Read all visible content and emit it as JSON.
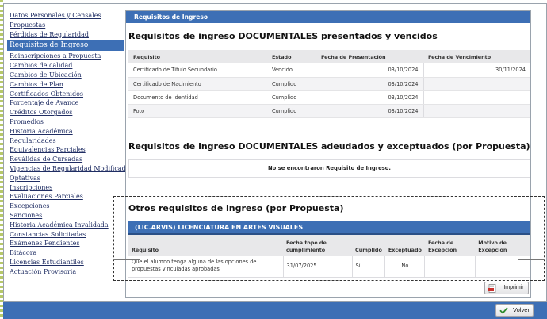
{
  "sidebar": {
    "items": [
      {
        "label": "Datos Personales y Censales",
        "active": false
      },
      {
        "label": "Propuestas",
        "active": false
      },
      {
        "label": "Pérdidas de Regularidad",
        "active": false
      },
      {
        "label": "Requisitos de Ingreso",
        "active": true
      },
      {
        "label": "Reinscripciones a Propuesta",
        "active": false
      },
      {
        "label": "Cambios de calidad",
        "active": false
      },
      {
        "label": "Cambios de Ubicación",
        "active": false
      },
      {
        "label": "Cambios de Plan",
        "active": false
      },
      {
        "label": "Certificados Obtenidos",
        "active": false
      },
      {
        "label": "Porcentaje de Avance",
        "active": false
      },
      {
        "label": "Créditos Otorgados",
        "active": false
      },
      {
        "label": "Promedios",
        "active": false
      },
      {
        "label": "Historia Académica",
        "active": false
      },
      {
        "label": "Regularidades",
        "active": false
      },
      {
        "label": "Equivalencias Parciales",
        "active": false
      },
      {
        "label": "Reválidas de Cursadas",
        "active": false
      },
      {
        "label": "Vigencias de Regularidad Modificadas",
        "active": false
      },
      {
        "label": "Optativas",
        "active": false
      },
      {
        "label": "Inscripciones",
        "active": false
      },
      {
        "label": "Evaluaciones Parciales",
        "active": false
      },
      {
        "label": "Excepciones",
        "active": false
      },
      {
        "label": "Sanciones",
        "active": false
      },
      {
        "label": "Historia Académica Invalidada",
        "active": false
      },
      {
        "label": "Constancias Solicitadas",
        "active": false
      },
      {
        "label": "Exámenes Pendientes",
        "active": false
      },
      {
        "label": "Bitácora",
        "active": false
      },
      {
        "label": "Licencias Estudiantiles",
        "active": false
      },
      {
        "label": "Actuación Provisoria",
        "active": false
      }
    ]
  },
  "main": {
    "header": "Requisitos de Ingreso",
    "section1": {
      "title": "Requisitos de ingreso DOCUMENTALES presentados y vencidos",
      "columns": [
        "Requisito",
        "Estado",
        "Fecha de Presentación",
        "Fecha de Vencimiento"
      ],
      "rows": [
        {
          "requisito": "Certificado de Título Secundario",
          "estado": "Vencido",
          "presentacion": "03/10/2024",
          "vencimiento": "30/11/2024"
        },
        {
          "requisito": "Certificado de Nacimiento",
          "estado": "Cumplido",
          "presentacion": "03/10/2024",
          "vencimiento": ""
        },
        {
          "requisito": "Documento de Identidad",
          "estado": "Cumplido",
          "presentacion": "03/10/2024",
          "vencimiento": ""
        },
        {
          "requisito": "Foto",
          "estado": "Cumplido",
          "presentacion": "03/10/2024",
          "vencimiento": ""
        }
      ]
    },
    "section2": {
      "title": "Requisitos de ingreso DOCUMENTALES adeudados y exceptuados (por Propuesta)",
      "empty_message": "No se encontraron Requisito de Ingreso."
    },
    "section3": {
      "title": "Otros requisitos de ingreso (por Propuesta)",
      "propuesta": "(LIC.ARVIS) LICENCIATURA EN ARTES VISUALES",
      "columns": [
        "Requisito",
        "Fecha tope de cumplimiento",
        "Cumplido",
        "Exceptuado",
        "Fecha de Excepción",
        "Motivo de Excepción"
      ],
      "rows": [
        {
          "requisito": "Que el alumno tenga alguna de las opciones de propuestas vinculadas aprobadas",
          "fecha_tope": "31/07/2025",
          "cumplido": "Sí",
          "exceptuado": "No",
          "fecha_excepcion": "",
          "motivo": ""
        }
      ]
    },
    "print_label": "Imprimir"
  },
  "footer": {
    "volver_label": "Volver"
  },
  "colors": {
    "accent": "#3d6fb5",
    "link": "#1f2d63"
  },
  "icons": {
    "print": "pdf-print-icon",
    "volver": "check-icon"
  }
}
